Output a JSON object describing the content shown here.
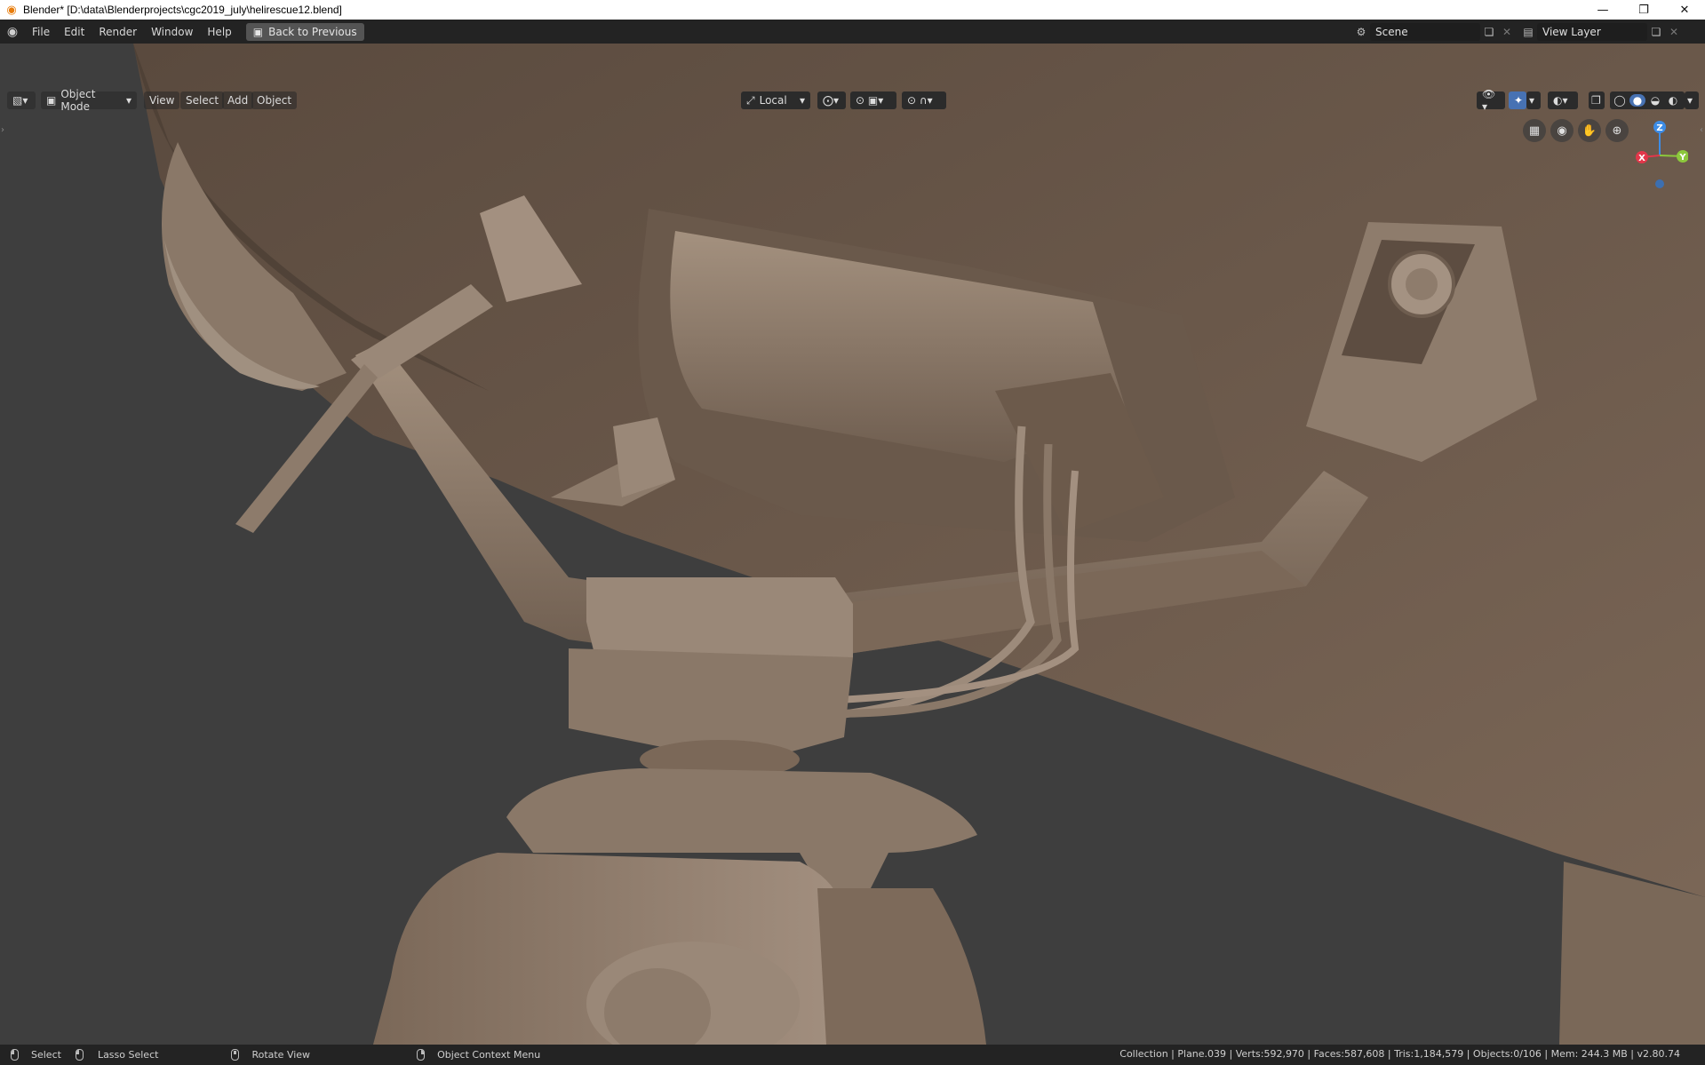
{
  "window": {
    "title": "Blender* [D:\\data\\Blenderprojects\\cgc2019_july\\helirescue12.blend]"
  },
  "menu": {
    "items": [
      "File",
      "Edit",
      "Render",
      "Window",
      "Help"
    ],
    "back_button": "Back to Previous"
  },
  "scene": {
    "label": "Scene"
  },
  "view_layer": {
    "label": "View Layer"
  },
  "viewport_header": {
    "mode": "Object Mode",
    "menus": [
      "View",
      "Select",
      "Add",
      "Object"
    ],
    "transform_orientation": "Local"
  },
  "gizmo": {
    "x": "X",
    "y": "Y",
    "z": "Z"
  },
  "statusbar": {
    "select": "Select",
    "lasso_select": "Lasso Select",
    "rotate_view": "Rotate View",
    "context_menu": "Object Context Menu",
    "stats": "Collection | Plane.039 | Verts:592,970 | Faces:587,608 | Tris:1,184,579 | Objects:0/106 | Mem: 244.3 MB | v2.80.74"
  },
  "colors": {
    "accent": "#4772b3",
    "axis_x": "#e2374a",
    "axis_y": "#8cc83c",
    "axis_z": "#3c8ce6",
    "model": "#8c7866",
    "background": "#3d3d3d"
  }
}
